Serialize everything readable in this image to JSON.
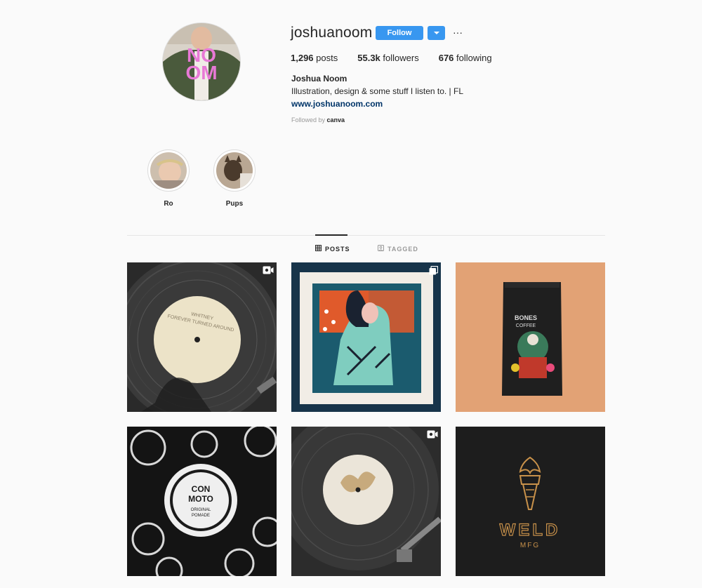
{
  "profile": {
    "username": "joshuanoom",
    "follow_label": "Follow",
    "more_label": "···",
    "stats": {
      "posts_count": "1,296",
      "posts_label": "posts",
      "followers_count": "55.3k",
      "followers_label": "followers",
      "following_count": "676",
      "following_label": "following"
    },
    "full_name": "Joshua Noom",
    "bio": "Illustration, design & some stuff I listen to. | FL",
    "website": "www.joshuanoom.com",
    "followed_by_prefix": "Followed by",
    "followed_by_user": "canva",
    "avatar_text_top": "NO",
    "avatar_text_bottom": "OM"
  },
  "highlights": [
    {
      "label": "Ro"
    },
    {
      "label": "Pups"
    }
  ],
  "tabs": [
    {
      "label": "POSTS",
      "active": true,
      "icon": "grid-icon"
    },
    {
      "label": "TAGGED",
      "active": false,
      "icon": "tag-icon"
    }
  ],
  "posts": [
    {
      "name": "post-record-whitney",
      "badge": "video-icon",
      "label_lines": [
        "WHITNEY",
        "FOREVER TURNED AROUND"
      ]
    },
    {
      "name": "post-bandana-illustration",
      "badge": "carousel-icon"
    },
    {
      "name": "post-bones-coffee",
      "badge": "",
      "label_lines": [
        "BONES",
        "COFFEE"
      ]
    },
    {
      "name": "post-con-moto-pomade",
      "badge": "",
      "label_lines": [
        "CON",
        "MOTO",
        "ORIGINAL",
        "POMADE"
      ]
    },
    {
      "name": "post-record-bonobo",
      "badge": "video-icon"
    },
    {
      "name": "post-weld-mfg",
      "badge": "",
      "label_lines": [
        "WELD",
        "MFG"
      ]
    }
  ],
  "colors": {
    "follow_blue": "#3897f0",
    "link": "#003569",
    "background": "#fafafa",
    "avatar_pink": "#e879d6",
    "coffee_bg": "#e2a275",
    "weld_gold": "#c8914a"
  }
}
